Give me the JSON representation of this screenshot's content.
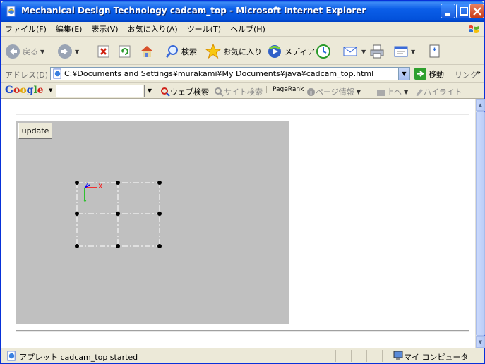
{
  "window": {
    "title": "Mechanical Design Technology cadcam_top - Microsoft Internet Explorer"
  },
  "menu": {
    "items": [
      "ファイル(F)",
      "編集(E)",
      "表示(V)",
      "お気に入り(A)",
      "ツール(T)",
      "ヘルプ(H)"
    ]
  },
  "toolbar": {
    "back_label": "戻る",
    "search_label": "検索",
    "favorites_label": "お気に入り",
    "media_label": "メディア"
  },
  "address": {
    "label": "アドレス(D)",
    "url": "C:¥Documents and Settings¥murakami¥My Documents¥java¥cadcam_top.html",
    "go_label": "移動",
    "links_label": "リンク",
    "links_more": "»"
  },
  "google": {
    "logo": [
      "G",
      "o",
      "o",
      "g",
      "l",
      "e"
    ],
    "search_value": "",
    "web_search_label": "ウェブ検索",
    "site_search_label": "サイト検索",
    "pagerank_label": "PageRank",
    "page_info_label": "ページ情報",
    "up_label": "上へ",
    "highlight_label": "ハイライト"
  },
  "applet": {
    "update_label": "update",
    "axis_labels": {
      "x": "X",
      "y": "Y",
      "z": "Z"
    },
    "background": "#c0c0c0"
  },
  "status": {
    "text": "アプレット cadcam_top started",
    "zone": "マイ コンピュータ"
  },
  "colors": {
    "title_bar": "#0352db",
    "axis_x": "#ff0000",
    "axis_y": "#00c000",
    "axis_z": "#0000ff"
  }
}
